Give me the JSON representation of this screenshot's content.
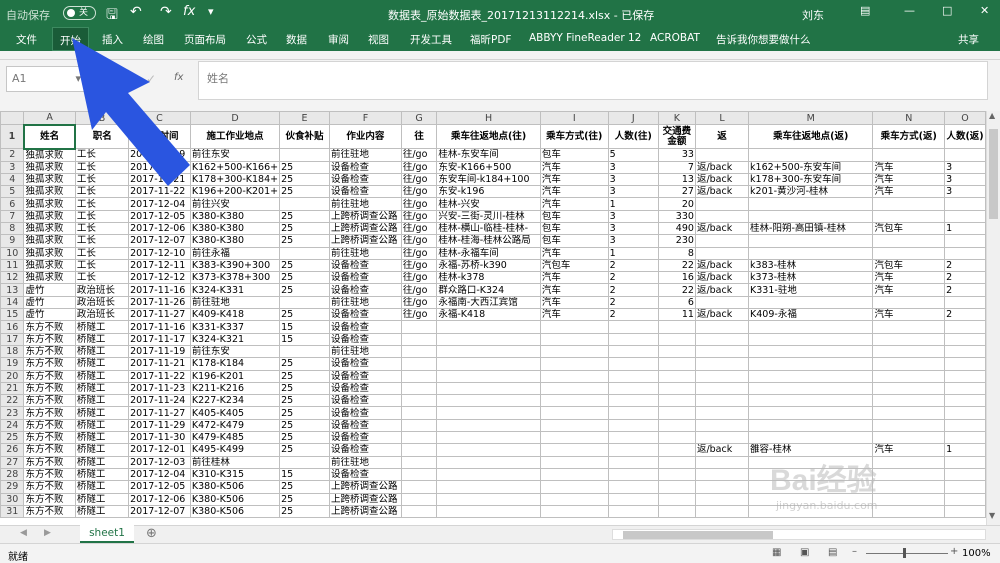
{
  "titlebar": {
    "autosave": "自动保存",
    "autosave_state": "关",
    "filename": "数据表_原始数据表_20171213112214.xlsx  -  已保存",
    "user": "刘东"
  },
  "ribbon": {
    "tabs": [
      "文件",
      "开始",
      "插入",
      "绘图",
      "页面布局",
      "公式",
      "数据",
      "审阅",
      "视图",
      "开发工具",
      "福昕PDF",
      "ABBYY FineReader 12",
      "ACROBAT"
    ],
    "active_tab": "开始",
    "tellme": "告诉我你想要做什么",
    "share": "共享"
  },
  "formula": {
    "cell_ref": "A1",
    "value": "姓名"
  },
  "columns": [
    "A",
    "B",
    "C",
    "D",
    "E",
    "F",
    "G",
    "H",
    "I",
    "J",
    "K",
    "L",
    "M",
    "N",
    "O"
  ],
  "headers": [
    "姓名",
    "职名",
    "日期时间",
    "施工作业地点",
    "伙食补贴",
    "作业内容",
    "往",
    "乘车往返地点(往)",
    "乘车方式(往)",
    "人数(往)",
    "交通费金额",
    "返",
    "乘车往返地点(返)",
    "乘车方式(返)",
    "人数(返)"
  ],
  "rows": [
    [
      "独孤求败",
      "工长",
      "2017-11-19",
      "前往东安",
      "",
      "前往驻地",
      "往/go",
      "桂林-东安车间",
      "包车",
      "5",
      "33",
      "",
      "",
      "",
      ""
    ],
    [
      "独孤求败",
      "工长",
      "2017-11-20",
      "K162+500-K166+",
      "25",
      "设备检查",
      "往/go",
      "东安-K166+500",
      "汽车",
      "3",
      "7",
      "返/back",
      "k162+500-东安车间",
      "汽车",
      "3"
    ],
    [
      "独孤求败",
      "工长",
      "2017-11-21",
      "K178+300-K184+",
      "25",
      "设备检查",
      "往/go",
      "东安车间-k184+100",
      "汽车",
      "3",
      "13",
      "返/back",
      "k178+300-东安车间",
      "汽车",
      "3"
    ],
    [
      "独孤求败",
      "工长",
      "2017-11-22",
      "K196+200-K201+",
      "25",
      "设备检查",
      "往/go",
      "东安-k196",
      "汽车",
      "3",
      "27",
      "返/back",
      "k201-黄沙河-桂林",
      "汽车",
      "3"
    ],
    [
      "独孤求败",
      "工长",
      "2017-12-04",
      "前往兴安",
      "",
      "前往驻地",
      "往/go",
      "桂林-兴安",
      "汽车",
      "1",
      "20",
      "",
      "",
      "",
      ""
    ],
    [
      "独孤求败",
      "工长",
      "2017-12-05",
      "K380-K380",
      "25",
      "上跨桥调查公路",
      "往/go",
      "兴安-三街-灵川-桂林",
      "包车",
      "3",
      "330",
      "",
      "",
      "",
      ""
    ],
    [
      "独孤求败",
      "工长",
      "2017-12-06",
      "K380-K380",
      "25",
      "上跨桥调查公路",
      "往/go",
      "桂林-横山-临桂-桂林-",
      "包车",
      "3",
      "490",
      "返/back",
      "桂林-阳朔-高田镇-桂林",
      "汽包车",
      "1"
    ],
    [
      "独孤求败",
      "工长",
      "2017-12-07",
      "K380-K380",
      "25",
      "上跨桥调查公路",
      "往/go",
      "桂林-桂海-桂林公路局",
      "包车",
      "3",
      "230",
      "",
      "",
      "",
      ""
    ],
    [
      "独孤求败",
      "工长",
      "2017-12-10",
      "前往永福",
      "",
      "前往驻地",
      "往/go",
      "桂林-永福车间",
      "汽车",
      "1",
      "8",
      "",
      "",
      "",
      ""
    ],
    [
      "独孤求败",
      "工长",
      "2017-12-11",
      "K383-K390+300",
      "25",
      "设备检查",
      "往/go",
      "永福-苏桥-k390",
      "汽包车",
      "2",
      "22",
      "返/back",
      "k383-桂林",
      "汽包车",
      "2"
    ],
    [
      "独孤求败",
      "工长",
      "2017-12-12",
      "K373-K378+300",
      "25",
      "设备检查",
      "往/go",
      "桂林-k378",
      "汽车",
      "2",
      "16",
      "返/back",
      "k373-桂林",
      "汽车",
      "2"
    ],
    [
      "虚竹",
      "政治班长",
      "2017-11-16",
      "K324-K331",
      "25",
      "设备检查",
      "往/go",
      "群众路口-K324",
      "汽车",
      "2",
      "22",
      "返/back",
      "K331-驻地",
      "汽车",
      "2"
    ],
    [
      "虚竹",
      "政治班长",
      "2017-11-26",
      "前往驻地",
      "",
      "前往驻地",
      "往/go",
      "永福南-大西江宾馆",
      "汽车",
      "2",
      "6",
      "",
      "",
      "",
      ""
    ],
    [
      "虚竹",
      "政治班长",
      "2017-11-27",
      "K409-K418",
      "25",
      "设备检查",
      "往/go",
      "永福-K418",
      "汽车",
      "2",
      "11",
      "返/back",
      "K409-永福",
      "汽车",
      "2"
    ],
    [
      "东方不败",
      "桥隧工",
      "2017-11-16",
      "K331-K337",
      "15",
      "设备检查",
      "",
      "",
      "",
      "",
      "",
      "",
      "",
      "",
      ""
    ],
    [
      "东方不败",
      "桥隧工",
      "2017-11-17",
      "K324-K321",
      "15",
      "设备检查",
      "",
      "",
      "",
      "",
      "",
      "",
      "",
      "",
      ""
    ],
    [
      "东方不败",
      "桥隧工",
      "2017-11-19",
      "前往东安",
      "",
      "前往驻地",
      "",
      "",
      "",
      "",
      "",
      "",
      "",
      "",
      ""
    ],
    [
      "东方不败",
      "桥隧工",
      "2017-11-21",
      "K178-K184",
      "25",
      "设备检查",
      "",
      "",
      "",
      "",
      "",
      "",
      "",
      "",
      ""
    ],
    [
      "东方不败",
      "桥隧工",
      "2017-11-22",
      "K196-K201",
      "25",
      "设备检查",
      "",
      "",
      "",
      "",
      "",
      "",
      "",
      "",
      ""
    ],
    [
      "东方不败",
      "桥隧工",
      "2017-11-23",
      "K211-K216",
      "25",
      "设备检查",
      "",
      "",
      "",
      "",
      "",
      "",
      "",
      "",
      ""
    ],
    [
      "东方不败",
      "桥隧工",
      "2017-11-24",
      "K227-K234",
      "25",
      "设备检查",
      "",
      "",
      "",
      "",
      "",
      "",
      "",
      "",
      ""
    ],
    [
      "东方不败",
      "桥隧工",
      "2017-11-27",
      "K405-K405",
      "25",
      "设备检查",
      "",
      "",
      "",
      "",
      "",
      "",
      "",
      "",
      ""
    ],
    [
      "东方不败",
      "桥隧工",
      "2017-11-29",
      "K472-K479",
      "25",
      "设备检查",
      "",
      "",
      "",
      "",
      "",
      "",
      "",
      "",
      ""
    ],
    [
      "东方不败",
      "桥隧工",
      "2017-11-30",
      "K479-K485",
      "25",
      "设备检查",
      "",
      "",
      "",
      "",
      "",
      "",
      "",
      "",
      ""
    ],
    [
      "东方不败",
      "桥隧工",
      "2017-12-01",
      "K495-K499",
      "25",
      "设备检查",
      "",
      "",
      "",
      "",
      "",
      "返/back",
      "雒容-桂林",
      "汽车",
      "1"
    ],
    [
      "东方不败",
      "桥隧工",
      "2017-12-03",
      "前往桂林",
      "",
      "前往驻地",
      "",
      "",
      "",
      "",
      "",
      "",
      "",
      "",
      ""
    ],
    [
      "东方不败",
      "桥隧工",
      "2017-12-04",
      "K310-K315",
      "15",
      "设备检查",
      "",
      "",
      "",
      "",
      "",
      "",
      "",
      "",
      ""
    ],
    [
      "东方不败",
      "桥隧工",
      "2017-12-05",
      "K380-K506",
      "25",
      "上跨桥调查公路",
      "",
      "",
      "",
      "",
      "",
      "",
      "",
      "",
      ""
    ],
    [
      "东方不败",
      "桥隧工",
      "2017-12-06",
      "K380-K506",
      "25",
      "上跨桥调查公路",
      "",
      "",
      "",
      "",
      "",
      "",
      "",
      "",
      ""
    ],
    [
      "东方不败",
      "桥隧工",
      "2017-12-07",
      "K380-K506",
      "25",
      "上跨桥调查公路",
      "",
      "",
      "",
      "",
      "",
      "",
      "",
      "",
      ""
    ]
  ],
  "sheet": {
    "tab": "sheet1"
  },
  "status": {
    "ready": "就绪",
    "zoom": "100%"
  },
  "watermark": {
    "brand": "Bai经验",
    "url": "jingyan.baidu.com"
  },
  "annotation": {
    "color": "#2a55e0"
  }
}
